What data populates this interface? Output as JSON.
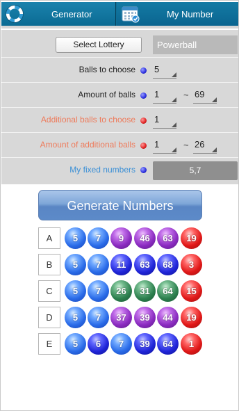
{
  "tabs": {
    "generator": {
      "label": "Generator",
      "icon": "lifebuoy-icon"
    },
    "my_number": {
      "label": "My Number",
      "icon": "calendar-icon"
    }
  },
  "settings": {
    "select_lottery_label": "Select Lottery",
    "lottery_name": "Powerball",
    "balls_to_choose": {
      "label": "Balls to choose",
      "value": "5"
    },
    "amount_of_balls": {
      "label": "Amount of balls",
      "min": "1",
      "separator": "~",
      "max": "69"
    },
    "additional_balls_to_choose": {
      "label": "Additional balls to choose",
      "value": "1"
    },
    "amount_of_additional_balls": {
      "label": "Amount of additional balls",
      "min": "1",
      "separator": "~",
      "max": "26"
    },
    "fixed_numbers": {
      "label": "My fixed numbers",
      "value": "5,7"
    }
  },
  "generate_label": "Generate Numbers",
  "results": [
    {
      "letter": "A",
      "balls": [
        {
          "n": "5",
          "c": "blue"
        },
        {
          "n": "7",
          "c": "blue"
        },
        {
          "n": "9",
          "c": "purple"
        },
        {
          "n": "46",
          "c": "purple"
        },
        {
          "n": "63",
          "c": "purple"
        },
        {
          "n": "19",
          "c": "red"
        }
      ]
    },
    {
      "letter": "B",
      "balls": [
        {
          "n": "5",
          "c": "blue"
        },
        {
          "n": "7",
          "c": "blue"
        },
        {
          "n": "11",
          "c": "navy"
        },
        {
          "n": "63",
          "c": "navy"
        },
        {
          "n": "68",
          "c": "navy"
        },
        {
          "n": "3",
          "c": "red"
        }
      ]
    },
    {
      "letter": "C",
      "balls": [
        {
          "n": "5",
          "c": "blue"
        },
        {
          "n": "7",
          "c": "blue"
        },
        {
          "n": "26",
          "c": "green"
        },
        {
          "n": "31",
          "c": "green"
        },
        {
          "n": "64",
          "c": "green"
        },
        {
          "n": "15",
          "c": "red"
        }
      ]
    },
    {
      "letter": "D",
      "balls": [
        {
          "n": "5",
          "c": "blue"
        },
        {
          "n": "7",
          "c": "blue"
        },
        {
          "n": "37",
          "c": "purple"
        },
        {
          "n": "39",
          "c": "purple"
        },
        {
          "n": "44",
          "c": "purple"
        },
        {
          "n": "19",
          "c": "red"
        }
      ]
    },
    {
      "letter": "E",
      "balls": [
        {
          "n": "5",
          "c": "blue"
        },
        {
          "n": "6",
          "c": "navy"
        },
        {
          "n": "7",
          "c": "blue"
        },
        {
          "n": "39",
          "c": "navy"
        },
        {
          "n": "64",
          "c": "navy"
        },
        {
          "n": "1",
          "c": "red"
        }
      ]
    }
  ],
  "colors": {
    "tab_bar": "#0d6f97",
    "fixed_ball": "#2a6be8",
    "bonus_ball": "#e01818",
    "settings_bg": "#d8d8d8"
  }
}
